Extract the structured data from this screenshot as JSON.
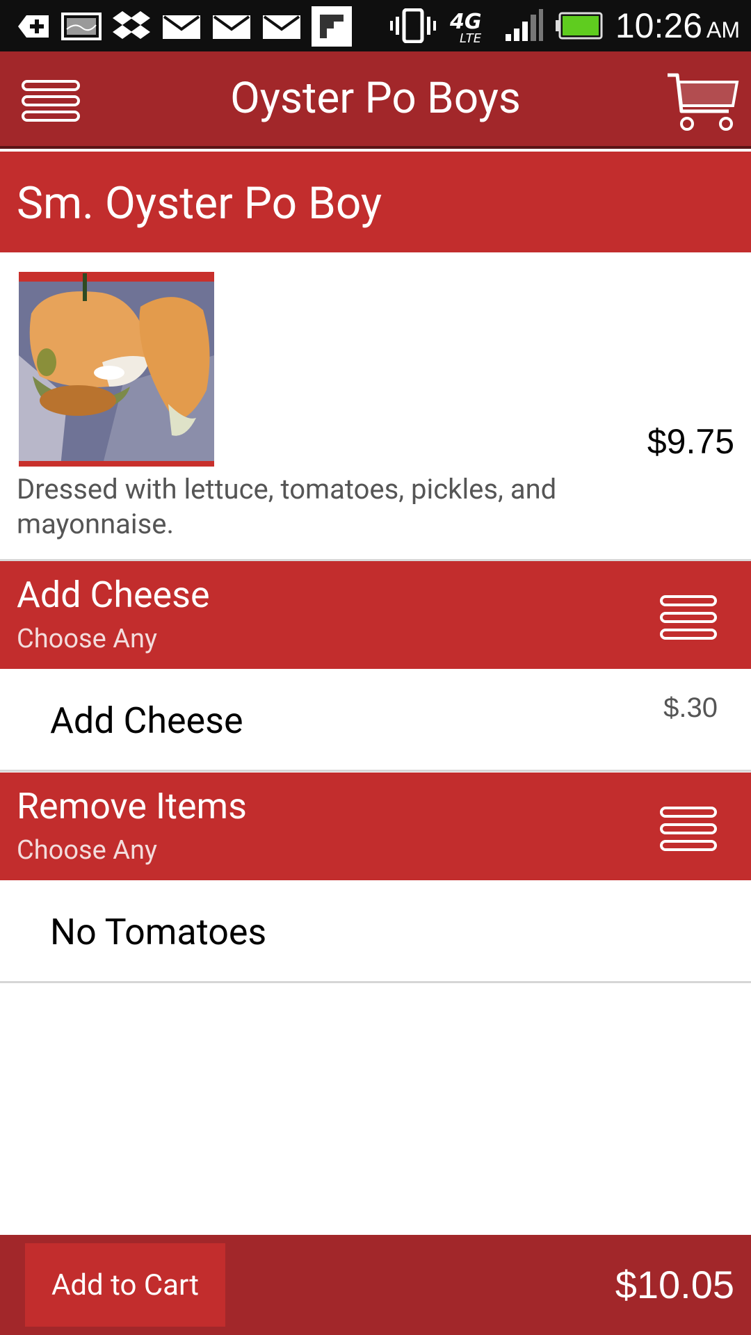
{
  "status_bar": {
    "time": "10:26",
    "ampm": "AM",
    "network": "4G LTE",
    "left_icons": [
      "plus-box-icon",
      "image-icon",
      "dropbox-icon",
      "mail-icon",
      "mail-icon",
      "mail-icon",
      "flipboard-icon"
    ],
    "right_icons": [
      "vibrate-icon",
      "4g-lte-icon",
      "signal-icon",
      "battery-icon"
    ]
  },
  "action_bar": {
    "title": "Oyster Po Boys",
    "menu_icon": "hamburger-icon",
    "cart_icon": "shopping-cart-icon"
  },
  "product": {
    "name": "Sm. Oyster Po Boy",
    "price": "$9.75",
    "description": "Dressed with lettuce, tomatoes, pickles, and mayonnaise."
  },
  "option_groups": [
    {
      "title": "Add Cheese",
      "subtitle": "Choose Any",
      "icon": "list-icon",
      "options": [
        {
          "label": "Add Cheese",
          "price": "$.30"
        }
      ]
    },
    {
      "title": "Remove Items",
      "subtitle": "Choose Any",
      "icon": "list-icon",
      "options": [
        {
          "label": "No Tomatoes",
          "price": ""
        }
      ]
    }
  ],
  "bottom_bar": {
    "add_to_cart_label": "Add to Cart",
    "total": "$10.05"
  },
  "colors": {
    "action_bar": "#a2272a",
    "section_red": "#c22d2d",
    "status_bar": "#0f0f0f",
    "battery_green": "#5fcc1f"
  }
}
